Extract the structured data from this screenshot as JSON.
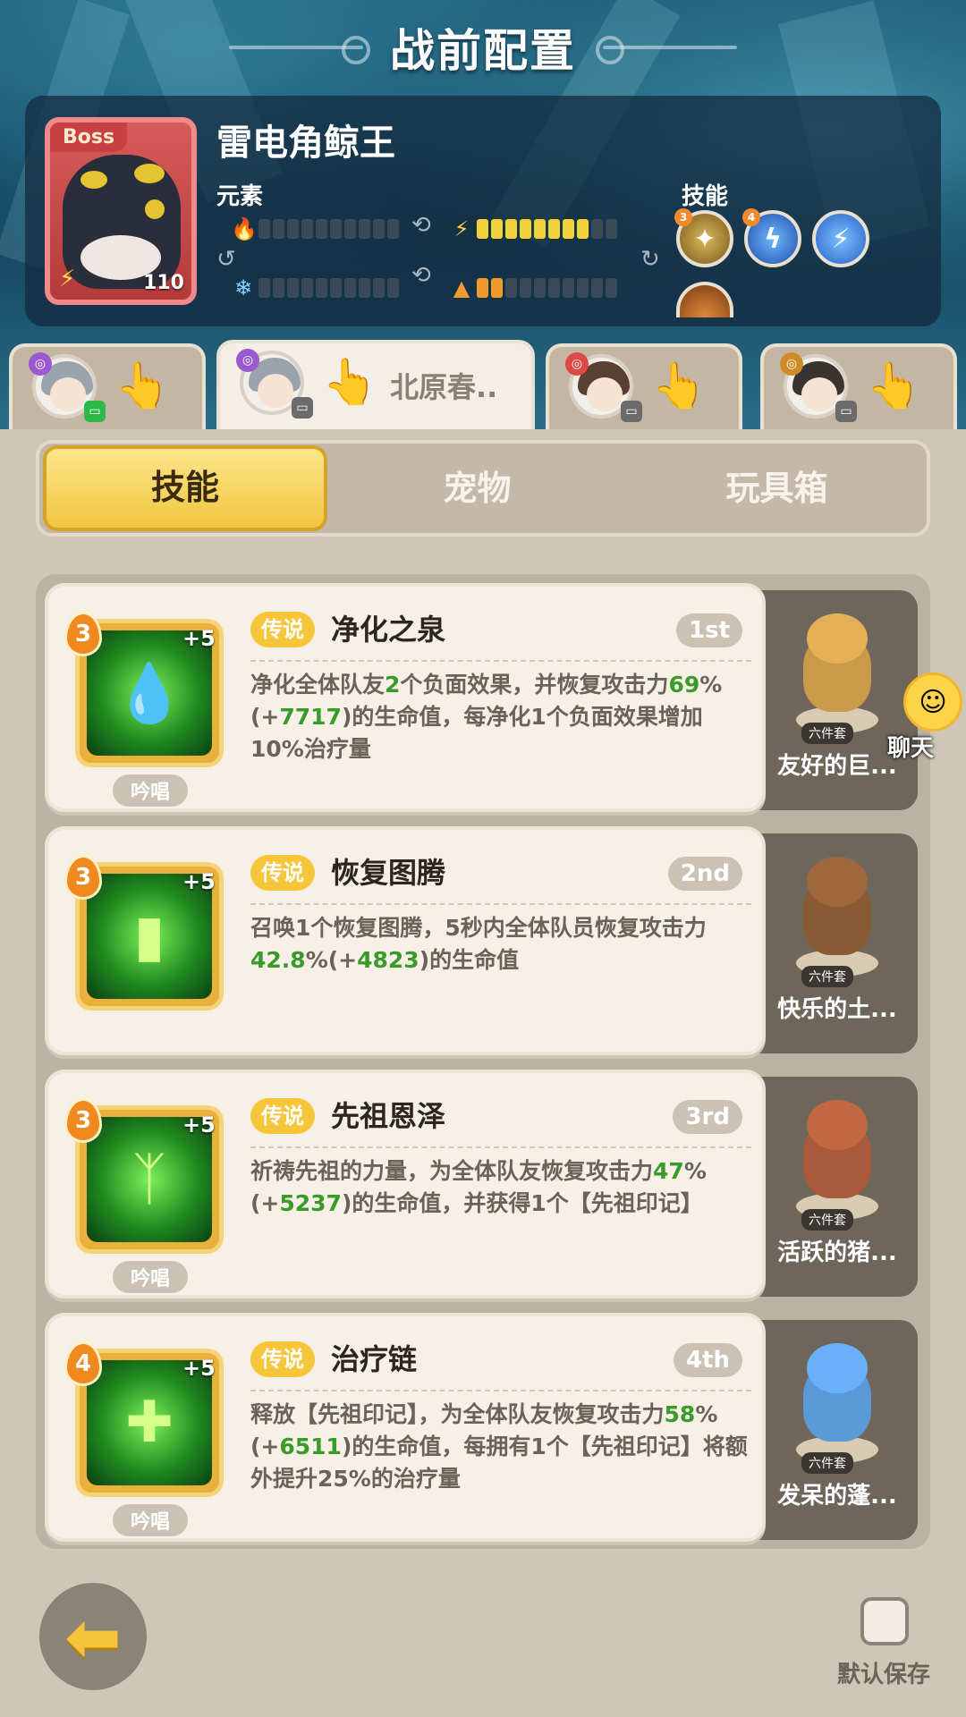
{
  "header": {
    "title": "战前配置"
  },
  "boss": {
    "tag": "Boss",
    "name": "雷电角鲸王",
    "level": "110",
    "elements_label": "元素",
    "skills_label": "技能",
    "element_bars": [
      {
        "icon": "fire-icon",
        "filled": 0,
        "total": 10
      },
      {
        "icon": "lightning-icon",
        "filled": 8,
        "total": 10
      },
      {
        "icon": "ice-icon",
        "filled": 0,
        "total": 10
      },
      {
        "icon": "earth-icon",
        "filled": 2,
        "total": 10
      }
    ],
    "skill_orbs": [
      {
        "icon": "claw-skill-icon",
        "level": "3"
      },
      {
        "icon": "lightning-burst-icon",
        "level": "4"
      },
      {
        "icon": "lightning-bolt-icon",
        "level": ""
      }
    ]
  },
  "character_tabs": [
    {
      "name": "",
      "element_color": "#9b59d0",
      "status_color": "#2eb84a",
      "status_icon": "chat-icon"
    },
    {
      "name": "北原春..",
      "element_color": "#9b59d0",
      "status_color": "#6b6b6b",
      "status_icon": "screen-icon"
    },
    {
      "name": "",
      "element_color": "#e04848",
      "status_color": "#6b6b6b",
      "status_icon": "screen-icon"
    },
    {
      "name": "",
      "element_color": "#d08a2a",
      "status_color": "#6b6b6b",
      "status_icon": "screen-icon"
    }
  ],
  "category_tabs": [
    "技能",
    "宠物",
    "玩具箱"
  ],
  "skills": [
    {
      "level": "3",
      "plus": "+5",
      "rarity": "传说",
      "name": "净化之泉",
      "order": "1st",
      "chant": "吟唱",
      "icon": "spring-drop-icon",
      "desc": [
        {
          "t": "净化全体队友"
        },
        {
          "t": "2",
          "g": true
        },
        {
          "t": "个负面效果，并恢复攻击力"
        },
        {
          "t": "69",
          "g": true
        },
        {
          "t": "%(+"
        },
        {
          "t": "7717",
          "g": true
        },
        {
          "t": ")的生命值，每净化1个负面效果增加10%治疗量"
        }
      ],
      "pet": {
        "name": "友好的巨...",
        "set": "六件套",
        "color": "#c89a4a"
      }
    },
    {
      "level": "3",
      "plus": "+5",
      "rarity": "传说",
      "name": "恢复图腾",
      "order": "2nd",
      "chant": "",
      "icon": "totem-icon",
      "desc": [
        {
          "t": "召唤1个恢复图腾，5秒内全体队员恢复攻击力"
        },
        {
          "t": "42.8",
          "g": true
        },
        {
          "t": "%(+"
        },
        {
          "t": "4823",
          "g": true
        },
        {
          "t": ")的生命值"
        }
      ],
      "pet": {
        "name": "快乐的土...",
        "set": "六件套",
        "color": "#8a5a34"
      }
    },
    {
      "level": "3",
      "plus": "+5",
      "rarity": "传说",
      "name": "先祖恩泽",
      "order": "3rd",
      "chant": "吟唱",
      "icon": "ancestor-spirit-icon",
      "desc": [
        {
          "t": "祈祷先祖的力量，为全体队友恢复攻击力"
        },
        {
          "t": "47",
          "g": true
        },
        {
          "t": "%(+"
        },
        {
          "t": "5237",
          "g": true
        },
        {
          "t": ")的生命值，并获得1个【先祖印记】"
        }
      ],
      "pet": {
        "name": "活跃的猪...",
        "set": "六件套",
        "color": "#a85a3a"
      }
    },
    {
      "level": "4",
      "plus": "+5",
      "rarity": "传说",
      "name": "治疗链",
      "order": "4th",
      "chant": "吟唱",
      "icon": "heal-chain-icon",
      "desc": [
        {
          "t": "释放【先祖印记】，为全体队友恢复攻击力"
        },
        {
          "t": "58",
          "g": true
        },
        {
          "t": "%(+"
        },
        {
          "t": "6511",
          "g": true
        },
        {
          "t": ")的生命值，每拥有1个【先祖印记】将额外提升25%的治疗量"
        }
      ],
      "pet": {
        "name": "发呆的蓬...",
        "set": "六件套",
        "color": "#5a9ad8"
      }
    }
  ],
  "chat": {
    "label": "聊天"
  },
  "footer": {
    "save_label": "默认保存",
    "save_checked": false
  }
}
